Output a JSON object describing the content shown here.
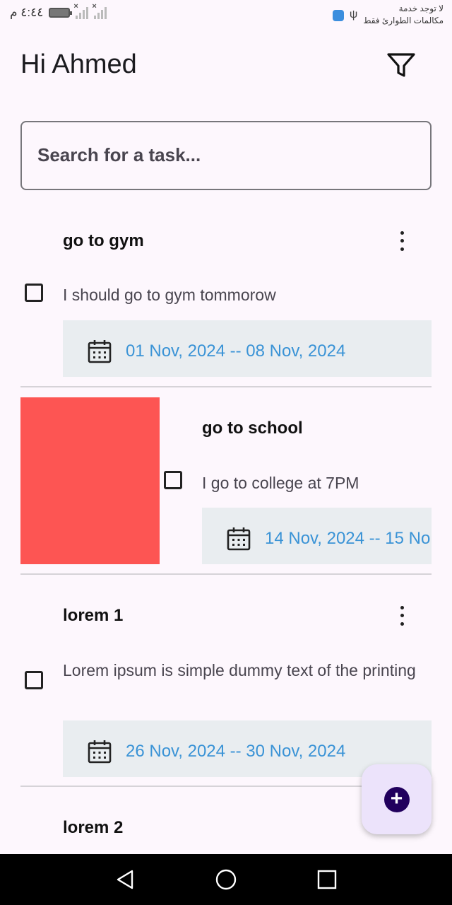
{
  "status_bar": {
    "time": "٤:٤٤ م",
    "carrier_line1": "لا توجد خدمة",
    "carrier_line2": "مكالمات الطوارئ فقط"
  },
  "header": {
    "greeting": "Hi Ahmed",
    "filter_icon": "filter-icon"
  },
  "search": {
    "placeholder": "Search for a task..."
  },
  "tasks": [
    {
      "title": "go to gym",
      "description": "I should go to gym tommorow",
      "date_range": "01 Nov, 2024 -- 08 Nov, 2024",
      "checked": false
    },
    {
      "title": "go to school",
      "description": "I go to college at 7PM",
      "date_range": "14 Nov, 2024 -- 15 No",
      "checked": false,
      "swipe_action_color": "#fd5553"
    },
    {
      "title": "lorem 1",
      "description": "Lorem ipsum is simple dummy text of the printing",
      "date_range": "26 Nov, 2024 -- 30 Nov, 2024",
      "checked": false
    },
    {
      "title": "lorem 2"
    }
  ],
  "fab": {
    "icon": "plus-icon"
  },
  "colors": {
    "background": "#fdf7fd",
    "date_text": "#3a93d6",
    "date_bar": "#e9edf0",
    "fab_bg": "#ece3fb",
    "fab_icon": "#21005d"
  }
}
